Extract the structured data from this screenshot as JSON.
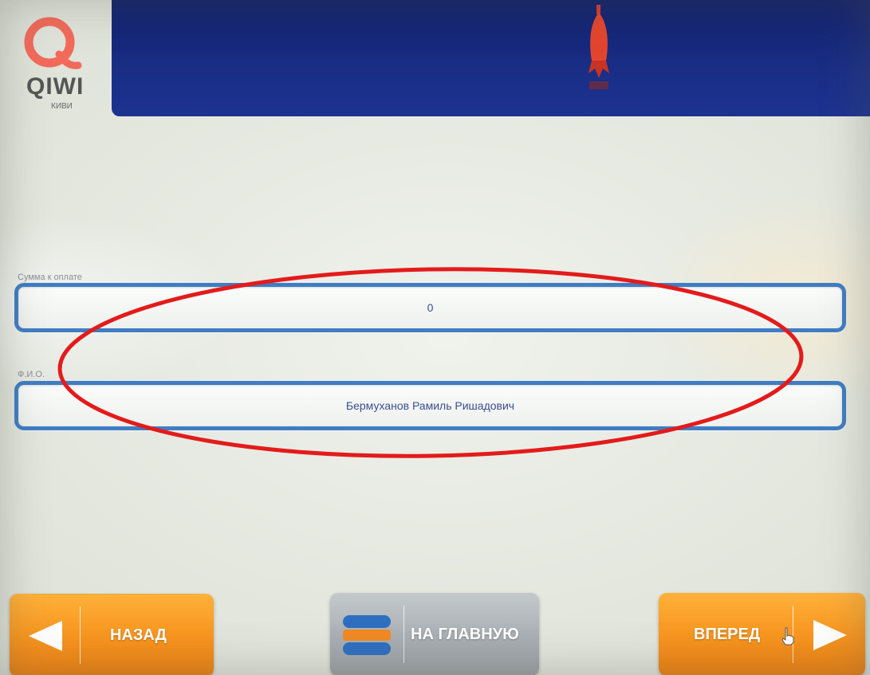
{
  "header": {
    "logo_text": "QIWI",
    "logo_subtext": "КИВИ"
  },
  "form": {
    "amount_label": "Сумма к оплате",
    "amount_value": "0",
    "fio_label": "Ф.И.О.",
    "fio_value": "Бермуханов Рамиль Ришадович"
  },
  "nav": {
    "back_label": "НАЗАД",
    "home_label": "НА ГЛАВНУЮ",
    "next_label": "ВПЕРЕД"
  },
  "colors": {
    "banner": "#1a2e86",
    "field_border": "#3f7dc4",
    "button_orange": "#f7941e",
    "button_gray": "#a8aeb2",
    "annotation": "#e31b1b"
  },
  "icons": {
    "logo": "qiwi-logo-icon",
    "operator": "operator-logo-icon",
    "back": "left-arrow-icon",
    "home": "home-stack-icon",
    "next": "right-arrow-icon",
    "cursor": "hand-cursor-icon"
  }
}
